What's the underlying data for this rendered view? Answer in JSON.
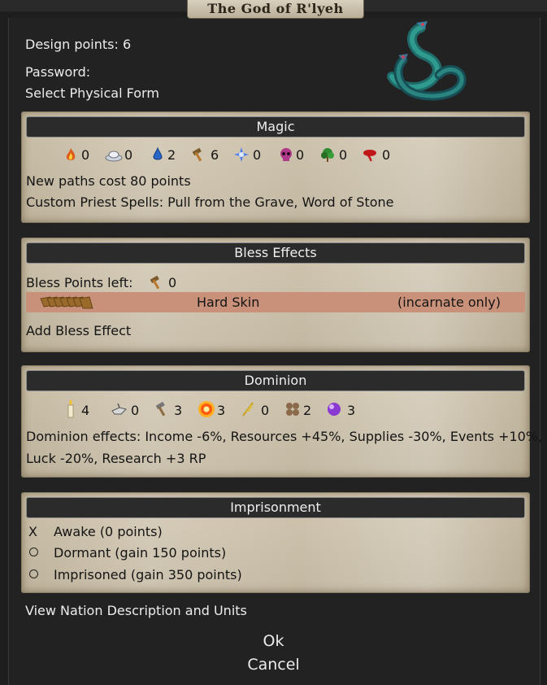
{
  "window": {
    "title": "The God of R'lyeh"
  },
  "header": {
    "design_points": "Design points: 6",
    "password_label": "Password:",
    "select_form": "Select Physical Form",
    "portrait_icon": "serpent-pretender-icon"
  },
  "magic": {
    "title": "Magic",
    "paths": [
      {
        "name": "fire-icon",
        "value": "0",
        "color": "#e05a1a"
      },
      {
        "name": "air-icon",
        "value": "0",
        "color": "#e8e8f0"
      },
      {
        "name": "water-icon",
        "value": "2",
        "color": "#2a66c8"
      },
      {
        "name": "earth-icon",
        "value": "6",
        "color": "#a0642a"
      },
      {
        "name": "astral-icon",
        "value": "0",
        "color": "#4a7af0"
      },
      {
        "name": "death-icon",
        "value": "0",
        "color": "#b03a8a"
      },
      {
        "name": "nature-icon",
        "value": "0",
        "color": "#2f8a2f"
      },
      {
        "name": "blood-icon",
        "value": "0",
        "color": "#c01818"
      }
    ],
    "new_paths_cost": "New paths cost 80 points",
    "priest_spells": "Custom Priest Spells: Pull from the Grave, Word of Stone"
  },
  "bless": {
    "title": "Bless Effects",
    "points_left_label": "Bless Points left:",
    "points_left_value": "0",
    "effect": {
      "name": "Hard Skin",
      "note": "(incarnate only)"
    },
    "add_label": "Add Bless Effect"
  },
  "dominion": {
    "title": "Dominion",
    "scales": [
      {
        "name": "order-candle-icon",
        "value": "4"
      },
      {
        "name": "productivity-icon",
        "value": "0"
      },
      {
        "name": "hammer-icon",
        "value": "3"
      },
      {
        "name": "heat-sun-icon",
        "value": "3"
      },
      {
        "name": "growth-icon",
        "value": "0"
      },
      {
        "name": "luck-clover-icon",
        "value": "2"
      },
      {
        "name": "magic-orb-icon",
        "value": "3"
      }
    ],
    "effects_line1": "Dominion effects: Income -6%, Resources +45%, Supplies -30%, Events +10%,",
    "effects_line2": "Luck -20%, Research +3 RP"
  },
  "imprisonment": {
    "title": "Imprisonment",
    "options": [
      {
        "marker": "X",
        "label": "Awake (0 points)"
      },
      {
        "marker": "",
        "label": "Dormant (gain 150 points)"
      },
      {
        "marker": "",
        "label": "Imprisoned (gain 350 points)"
      }
    ]
  },
  "footer": {
    "view_nation": "View Nation Description and Units",
    "ok": "Ok",
    "cancel": "Cancel"
  }
}
